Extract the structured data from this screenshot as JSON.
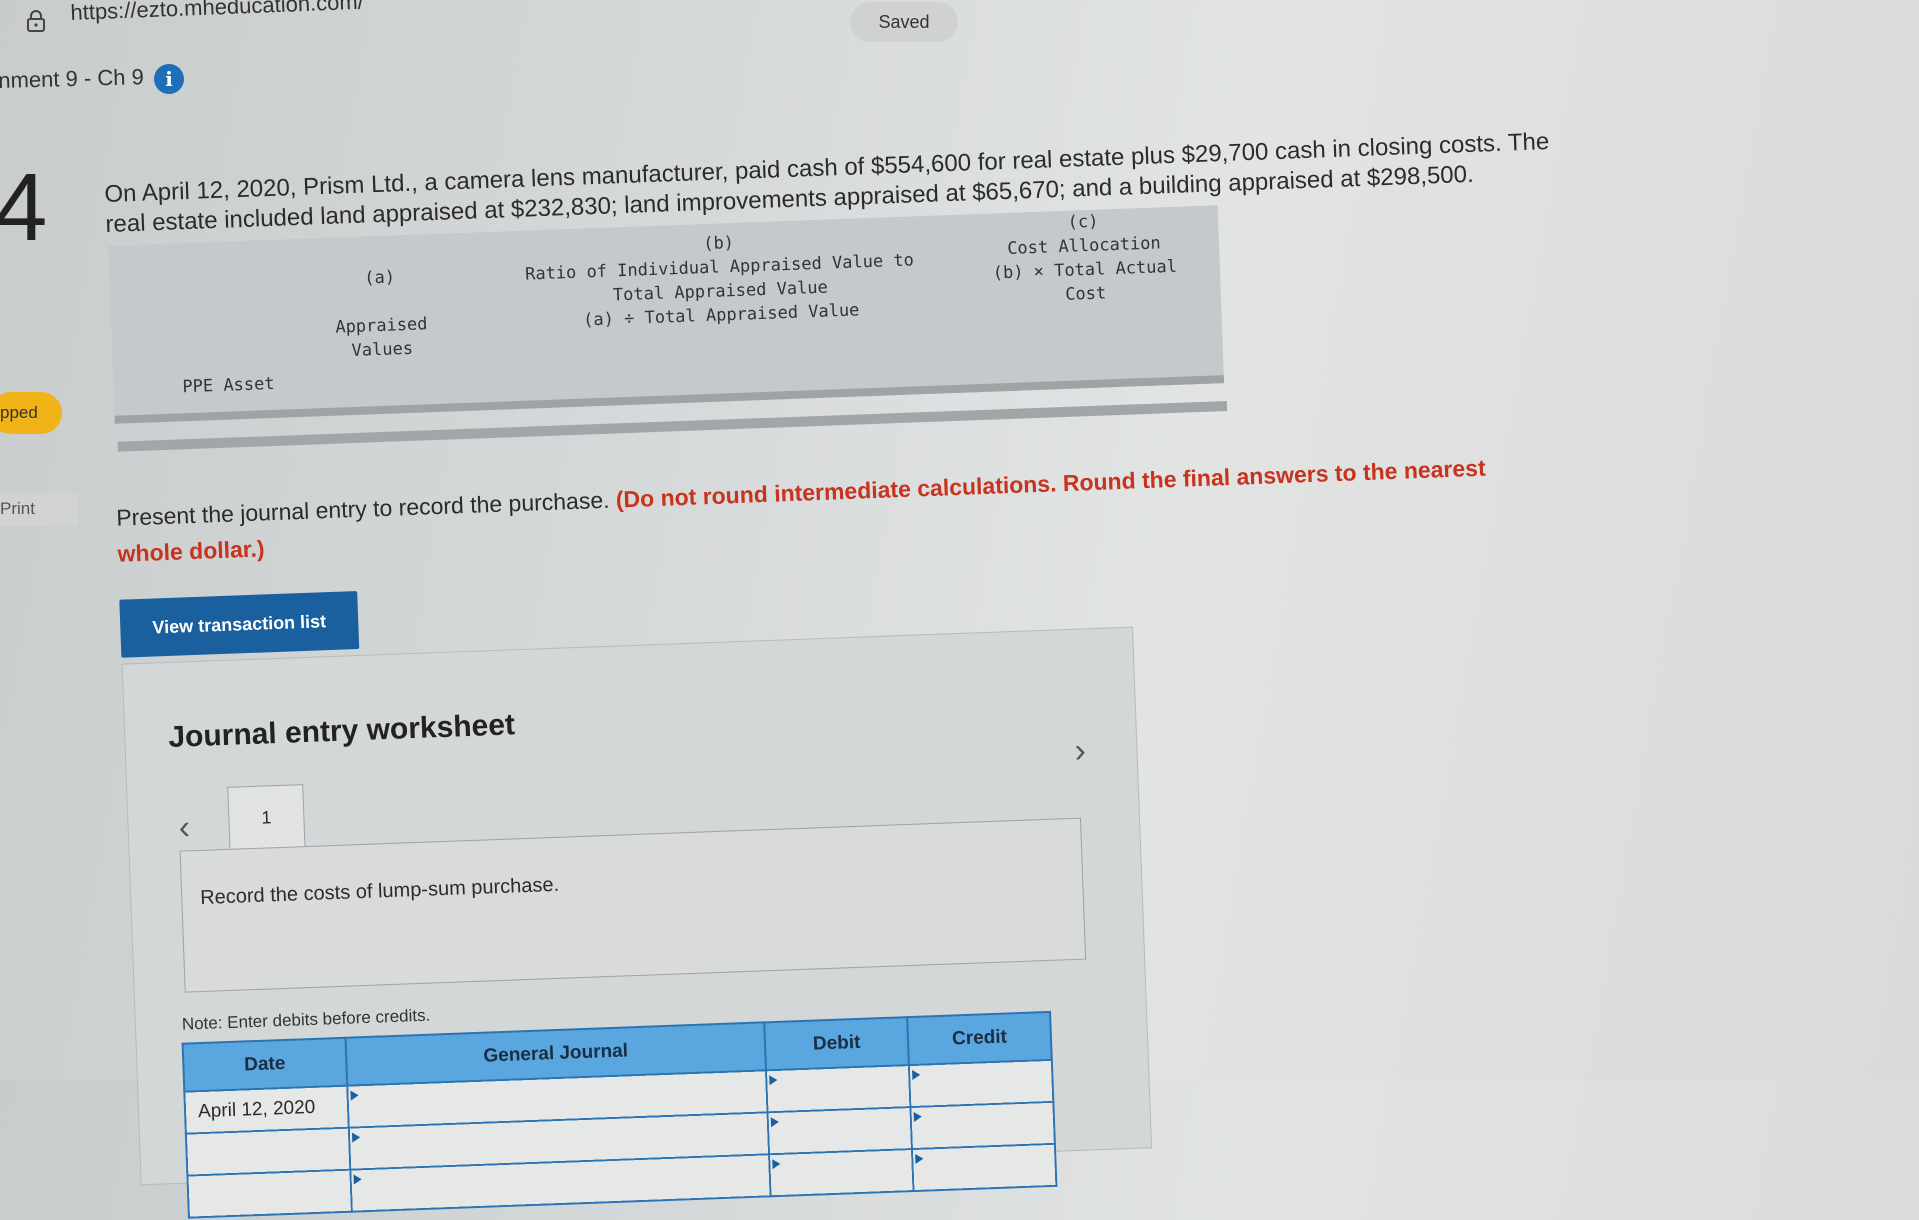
{
  "browser": {
    "url": "https://ezto.mheducation.com/",
    "status": "Saved"
  },
  "assignment": {
    "title": "nment 9 - Ch 9",
    "question_number": "4",
    "skipped_label": "pped",
    "print_label": "Print"
  },
  "problem": {
    "text": "On April 12, 2020, Prism Ltd., a camera lens manufacturer, paid cash of $554,600 for real estate plus $29,700 cash in closing costs. The real estate included land appraised at $232,830; land improvements appraised at $65,670; and a building appraised at $298,500."
  },
  "allocation_table": {
    "col_a": "(a)\n\nAppraised\nValues",
    "col_b": "(b)\nRatio of Individual Appraised Value to\nTotal Appraised Value\n(a) ÷ Total Appraised Value",
    "col_c": "(c)\nCost Allocation\n(b) × Total Actual\nCost",
    "col_asset": "PPE Asset"
  },
  "instruction": {
    "text": "Present the journal entry to record the purchase.",
    "emphasis": "(Do not round intermediate calculations. Round the final answers to the nearest whole dollar.)"
  },
  "view_transaction_button": "View transaction list",
  "worksheet": {
    "title": "Journal entry worksheet",
    "tab": "1",
    "description": "Record the costs of lump-sum purchase.",
    "note": "Note: Enter debits before credits.",
    "columns": {
      "date": "Date",
      "general_journal": "General Journal",
      "debit": "Debit",
      "credit": "Credit"
    },
    "rows": [
      {
        "date": "April 12, 2020",
        "account": "",
        "debit": "",
        "credit": ""
      },
      {
        "date": "",
        "account": "",
        "debit": "",
        "credit": ""
      },
      {
        "date": "",
        "account": "",
        "debit": "",
        "credit": ""
      }
    ]
  }
}
